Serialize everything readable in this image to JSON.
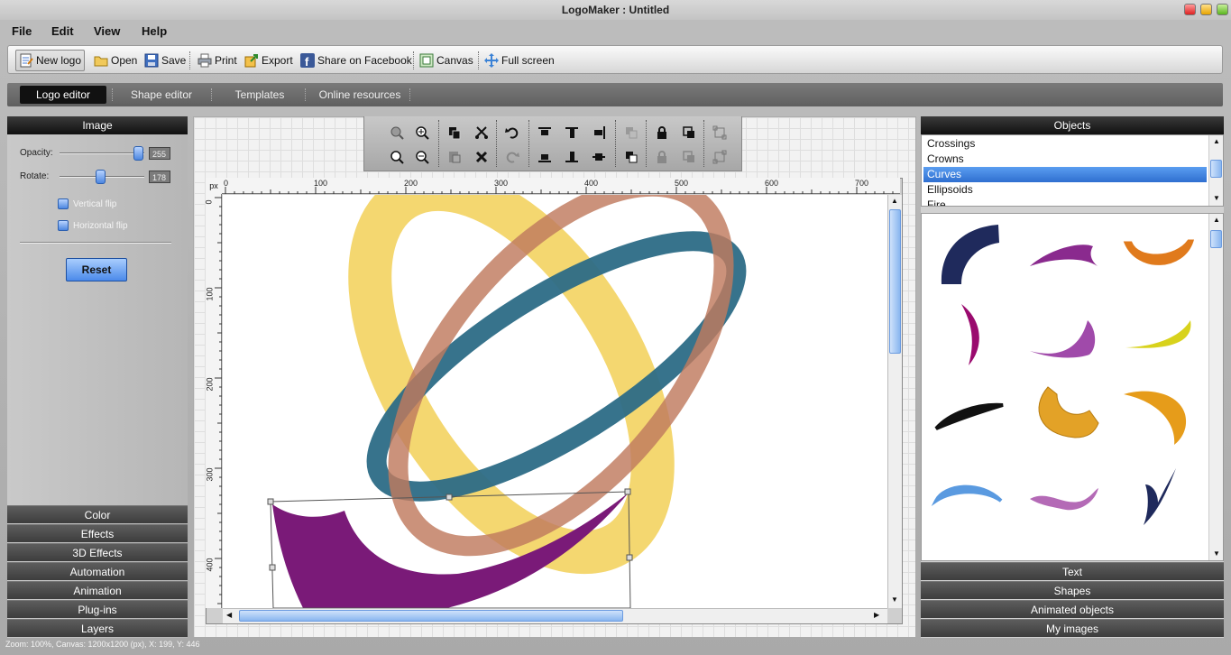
{
  "window": {
    "title": "LogoMaker : Untitled"
  },
  "menu": [
    "File",
    "Edit",
    "View",
    "Help"
  ],
  "toolbar": {
    "new_logo": "New logo",
    "open": "Open",
    "save": "Save",
    "print": "Print",
    "export": "Export",
    "share": "Share on Facebook",
    "canvas": "Canvas",
    "fullscreen": "Full screen"
  },
  "tabs": [
    "Logo editor",
    "Shape editor",
    "Templates",
    "Online resources"
  ],
  "left_panel": {
    "header": "Image",
    "opacity_label": "Opacity:",
    "opacity_value": "255",
    "rotate_label": "Rotate:",
    "rotate_value": "178",
    "vertical_flip": "Vertical flip",
    "horizontal_flip": "Horizontal flip",
    "reset": "Reset",
    "sections": [
      "Color",
      "Effects",
      "3D Effects",
      "Automation",
      "Animation",
      "Plug-ins",
      "Layers"
    ]
  },
  "ruler": {
    "unit": "px",
    "top_ticks": [
      "0",
      "100",
      "200",
      "300",
      "400",
      "500",
      "600",
      "700"
    ],
    "left_ticks": [
      "0",
      "100",
      "200",
      "300",
      "400"
    ]
  },
  "right_panel": {
    "header": "Objects",
    "objects": [
      "Crossings",
      "Crowns",
      "Curves",
      "Ellipsoids",
      "Fire"
    ],
    "selected_object": "Curves",
    "sections": [
      "Text",
      "Shapes",
      "Animated objects",
      "My images"
    ]
  },
  "status": {
    "text": "Zoom: 100%, Canvas: 1200x1200 (px), X: 199, Y: 446"
  },
  "colors": {
    "accent": "#3b7fe0",
    "logo_yellow": "#f2d25c",
    "logo_teal": "#2c6b86",
    "logo_copper": "#c07a5e",
    "logo_purple": "#7a1a78"
  }
}
